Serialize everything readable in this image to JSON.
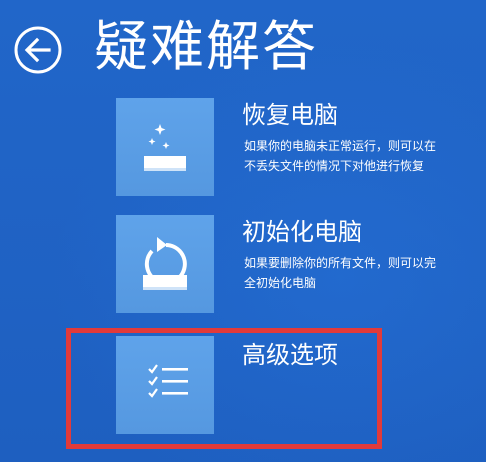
{
  "header": {
    "back_icon": "back-arrow-circle-icon",
    "title": "疑难解答"
  },
  "options": [
    {
      "icon": "refresh-sparkle-icon",
      "title": "恢复电脑",
      "desc_lines": [
        "如果你的电脑未正常运行，则可以在",
        "不丢失文件的情况下对他进行恢复"
      ]
    },
    {
      "icon": "reset-circular-arrow-icon",
      "title": "初始化电脑",
      "desc_lines": [
        "如果要删除你的所有文件，则可以完",
        "全初始化电脑"
      ]
    },
    {
      "icon": "checklist-icon",
      "title": "高级选项"
    }
  ],
  "colors": {
    "background": "#1f63c4",
    "tile": "#5a9ee6",
    "highlight": "#e23a3a",
    "text": "#ffffff"
  }
}
